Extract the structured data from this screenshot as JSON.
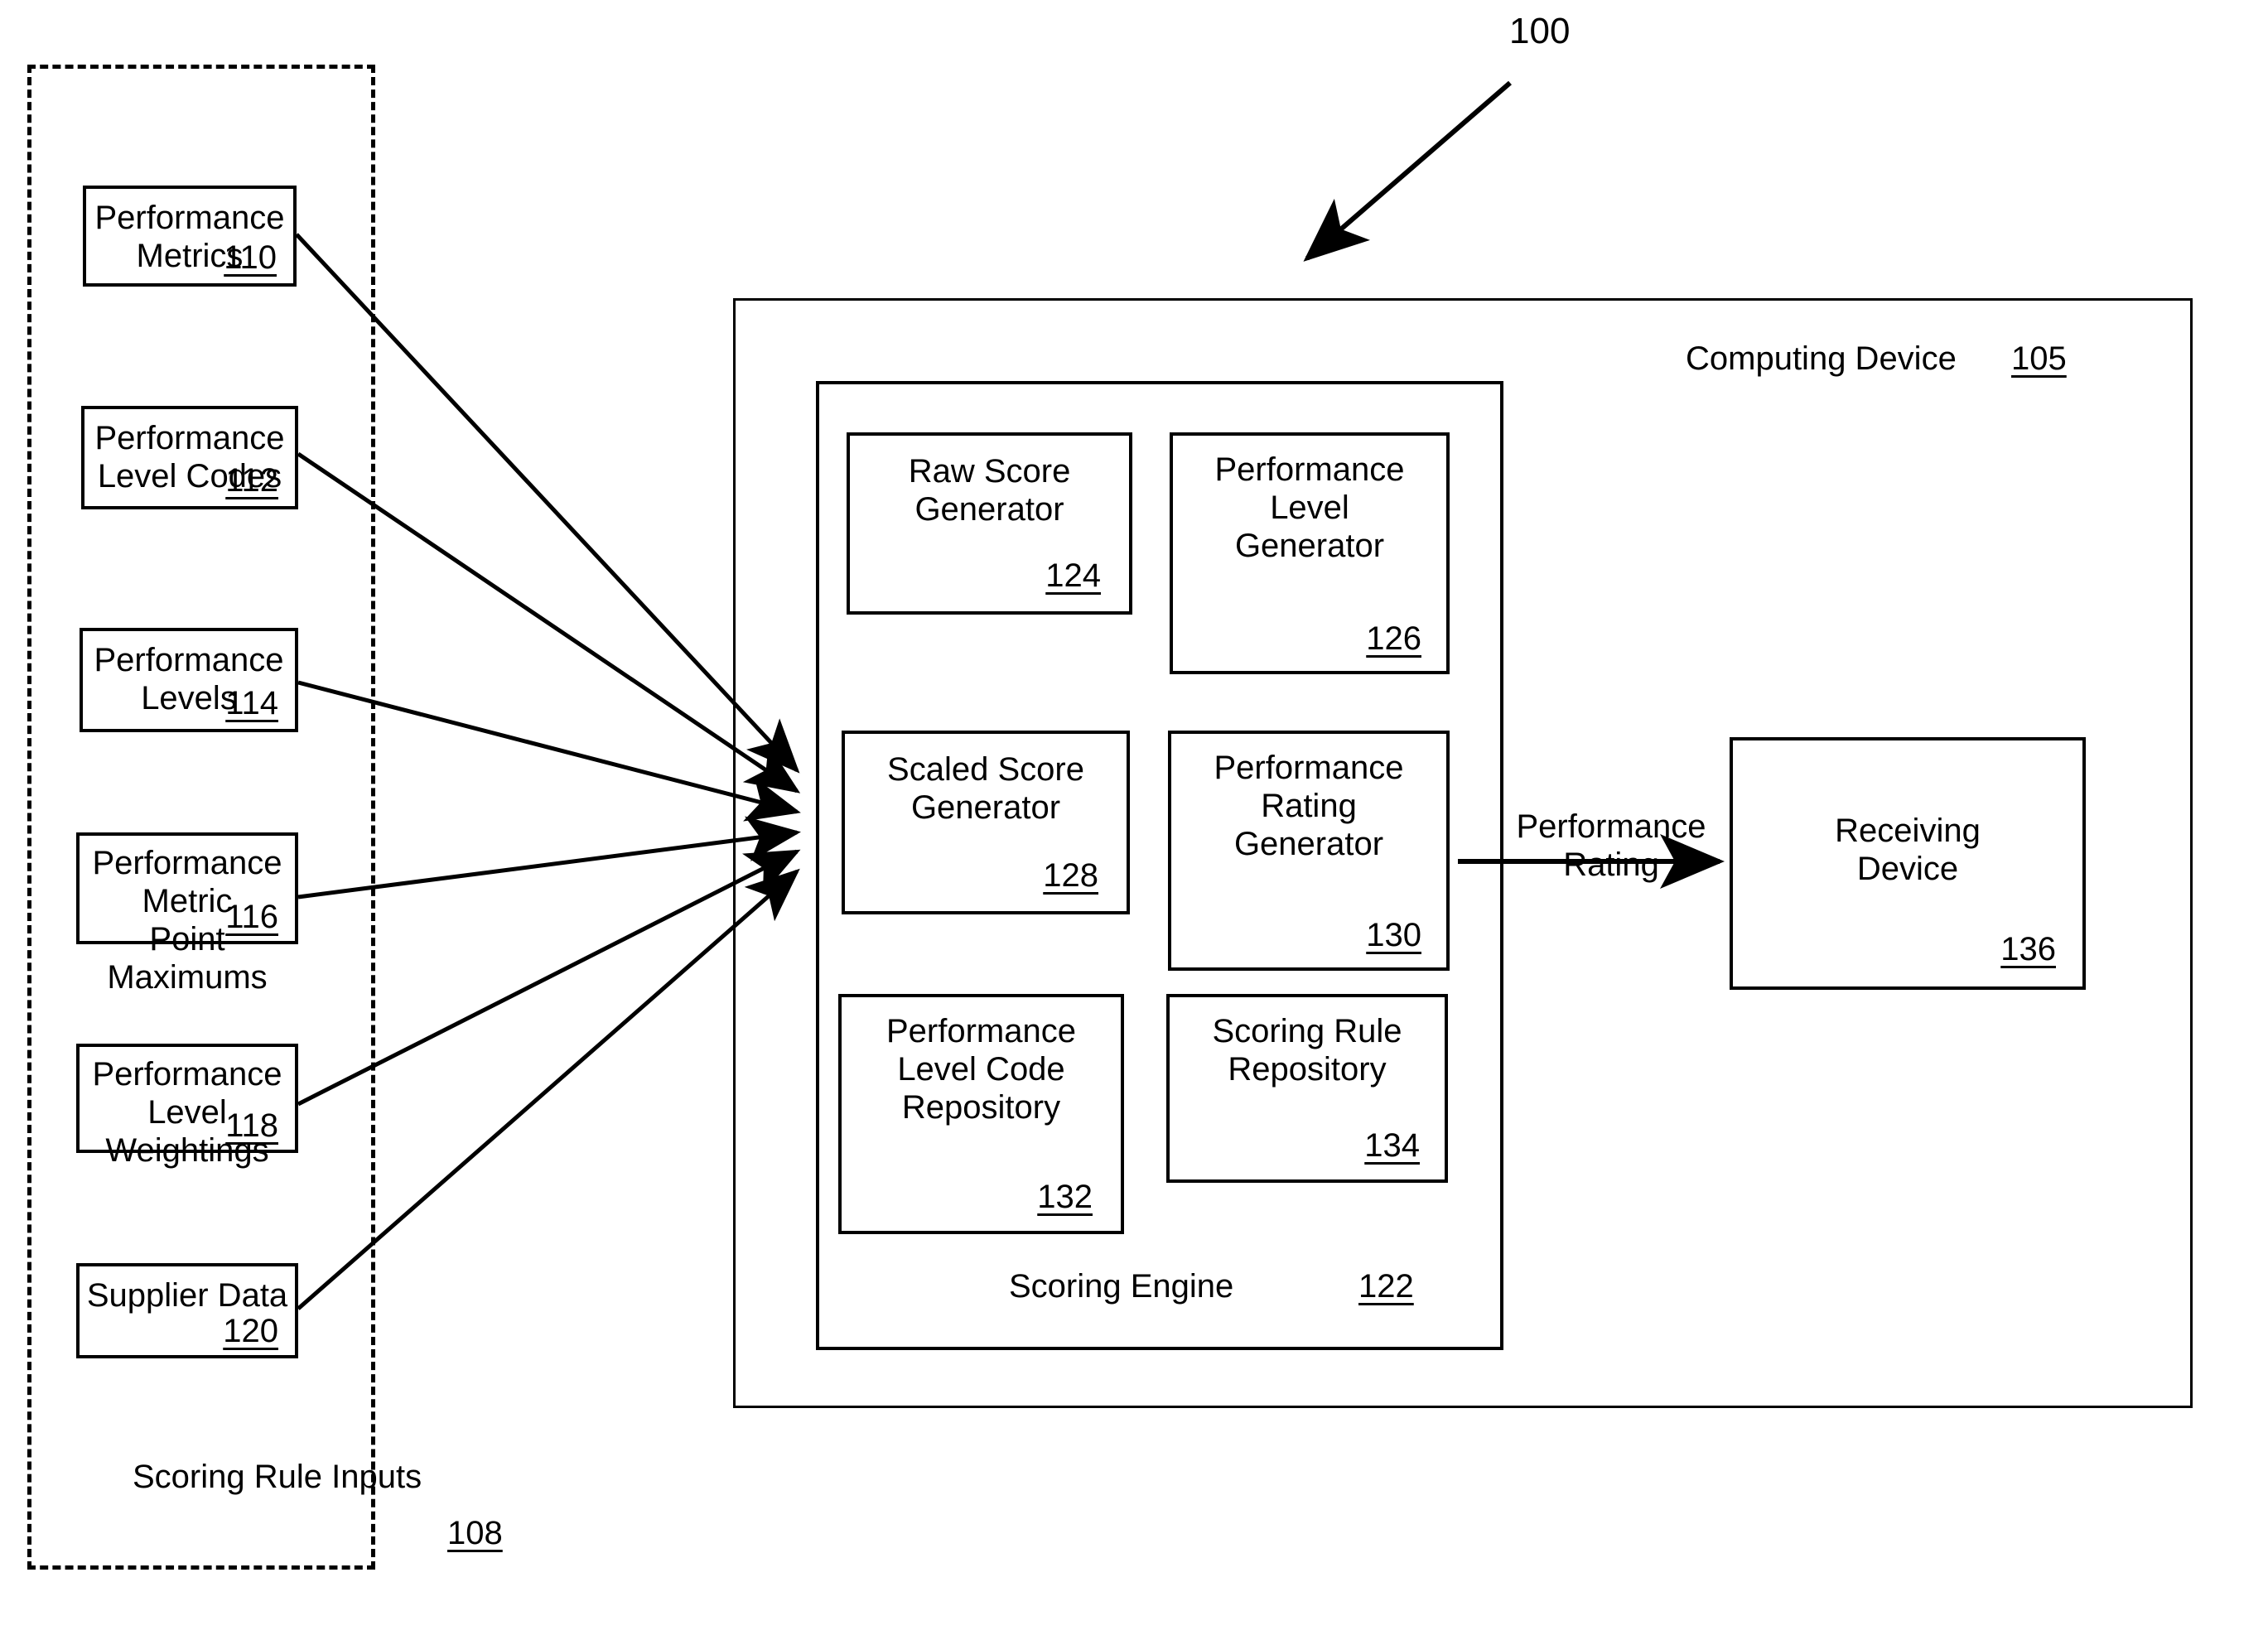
{
  "figure": {
    "figure_ref": "100",
    "dashed_group": {
      "label": "Scoring Rule Inputs",
      "ref": "108"
    },
    "computing_device": {
      "label": "Computing Device",
      "ref": "105"
    },
    "scoring_engine": {
      "label": "Scoring Engine",
      "ref": "122"
    },
    "input_boxes": [
      {
        "label": "Performance\nMetrics",
        "ref": "110"
      },
      {
        "label": "Performance\nLevel Codes",
        "ref": "112"
      },
      {
        "label": "Performance\nLevels",
        "ref": "114"
      },
      {
        "label": "Performance Metric\nPoint Maximums",
        "ref": "116"
      },
      {
        "label": "Performance Level\nWeightings",
        "ref": "118"
      },
      {
        "label": "Supplier Data",
        "ref": "120"
      }
    ],
    "engine_modules": [
      {
        "label": "Raw Score\nGenerator",
        "ref": "124"
      },
      {
        "label": "Performance\nLevel\nGenerator",
        "ref": "126"
      },
      {
        "label": "Scaled Score\nGenerator",
        "ref": "128"
      },
      {
        "label": "Performance\nRating\nGenerator",
        "ref": "130"
      },
      {
        "label": "Performance\nLevel Code\nRepository",
        "ref": "132"
      },
      {
        "label": "Scoring Rule\nRepository",
        "ref": "134"
      }
    ],
    "output": {
      "edge_label": "Performance\nRating",
      "receiving_device": {
        "label": "Receiving\nDevice",
        "ref": "136"
      }
    }
  }
}
